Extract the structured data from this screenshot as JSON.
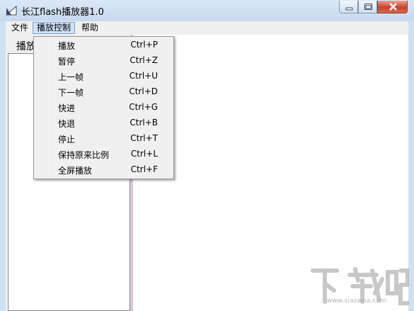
{
  "window": {
    "title": "长江flash播放器1.0",
    "buttons": [
      "minimize-icon",
      "maximize-icon",
      "close-icon"
    ]
  },
  "menubar": {
    "items": [
      {
        "label": "文件"
      },
      {
        "label": "播放控制",
        "active": true
      },
      {
        "label": "帮助"
      }
    ]
  },
  "left_pane": {
    "tab_label": "播放"
  },
  "dropdown": {
    "items": [
      {
        "label": "播放",
        "shortcut": "Ctrl+P"
      },
      {
        "label": "暂停",
        "shortcut": "Ctrl+Z"
      },
      {
        "label": "上一帧",
        "shortcut": "Ctrl+U"
      },
      {
        "label": "下一帧",
        "shortcut": "Ctrl+D"
      },
      {
        "label": "快进",
        "shortcut": "Ctrl+G"
      },
      {
        "label": "快退",
        "shortcut": "Ctrl+B"
      },
      {
        "label": "停止",
        "shortcut": "Ctrl+T"
      },
      {
        "label": "保持原来比例",
        "shortcut": "Ctrl+L"
      },
      {
        "label": "全屏播放",
        "shortcut": "Ctrl+F"
      }
    ]
  },
  "watermark": {
    "text": "下载吧",
    "url": "www.xiazaiba.com"
  },
  "colors": {
    "titlebar": "#c6d9ef",
    "menu_highlight": "#cfe3f8",
    "splitter": "#dcc4e0",
    "close_button": "#c7422c"
  }
}
